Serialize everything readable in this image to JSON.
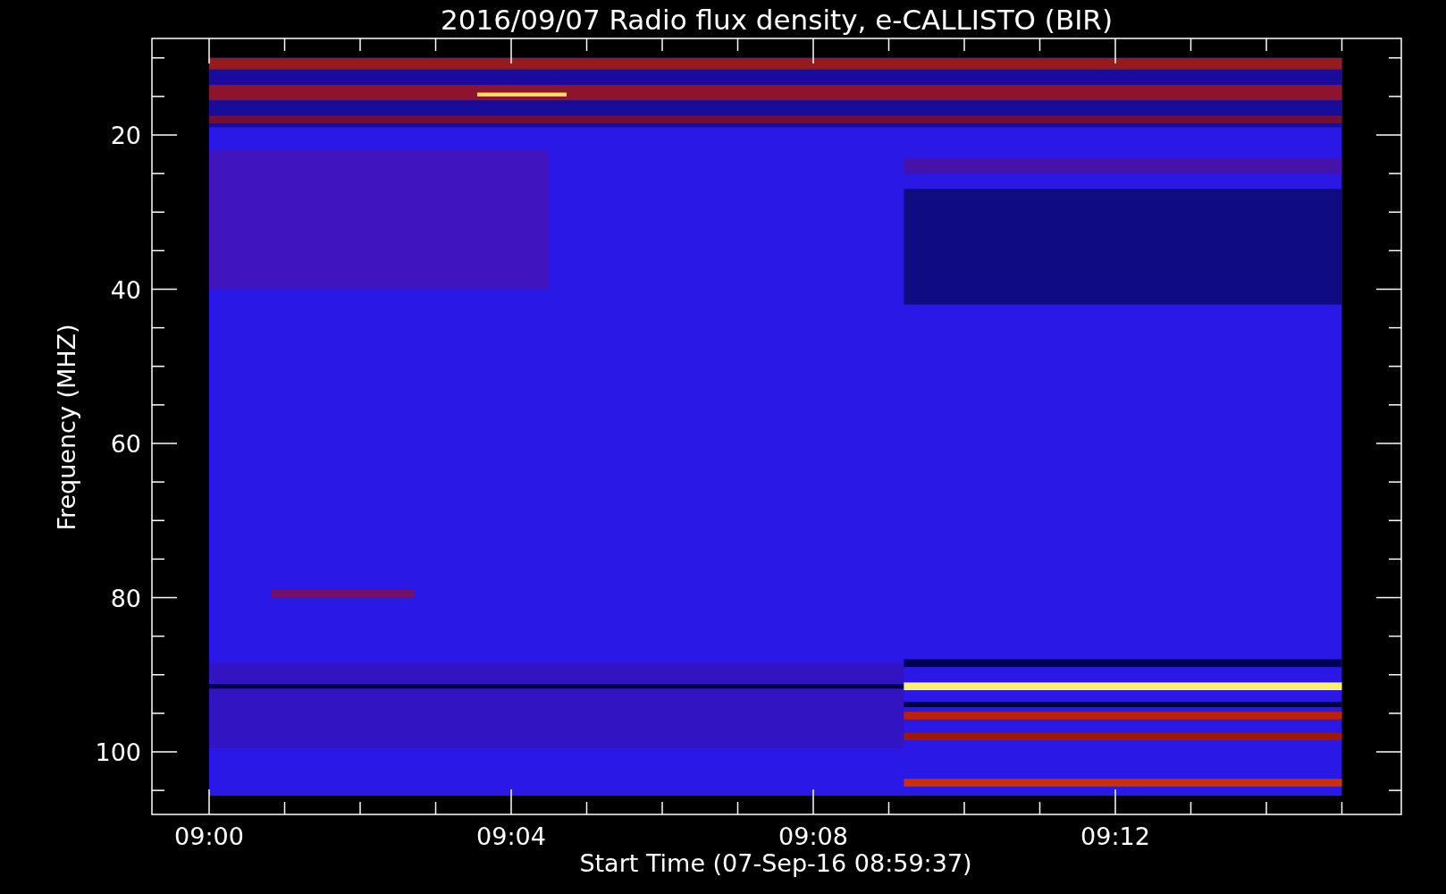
{
  "plot": {
    "title": "2016/09/07  Radio flux density, e-CALLISTO (BIR)",
    "ylabel": "Frequency (MHZ)",
    "xlabel": "Start Time (07-Sep-16 08:59:37)",
    "yticks": [
      "20",
      "40",
      "60",
      "80",
      "100"
    ],
    "xticks": [
      "09:00",
      "09:04",
      "09:08",
      "09:12"
    ]
  }
}
